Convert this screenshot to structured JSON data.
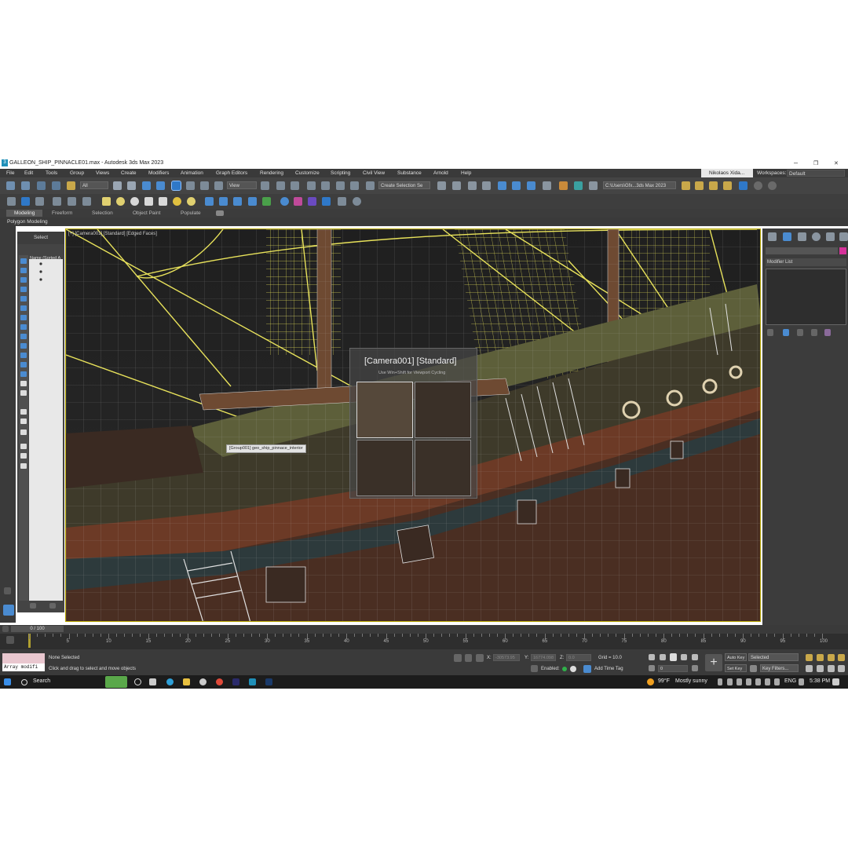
{
  "window": {
    "title": "GALLEON_SHIP_PINNACLE01.max - Autodesk 3ds Max 2023",
    "app_icon": "3",
    "minimize_glyph": "–",
    "restore_glyph": "❐",
    "close_glyph": "✕"
  },
  "menu": {
    "items": [
      "File",
      "Edit",
      "Tools",
      "Group",
      "Views",
      "Create",
      "Modifiers",
      "Animation",
      "Graph Editors",
      "Rendering",
      "Customize",
      "Scripting",
      "Civil View",
      "Substance",
      "Arnold",
      "Help"
    ],
    "user": "Nikolaos Xida...",
    "workspaces_label": "Workspaces:",
    "workspace_value": "Default"
  },
  "toolbar": {
    "filter_value": "All",
    "refcoord_value": "View",
    "selection_set_placeholder": "Create Selection Se",
    "project_path": "C:\\Users\\Gfx...3ds Max 2023"
  },
  "ribbon": {
    "tabs": [
      "Modeling",
      "Freeform",
      "Selection",
      "Object Paint",
      "Populate"
    ],
    "sub_label": "Polygon Modeling"
  },
  "scene_explorer": {
    "select_label": "Select",
    "column_header": "Name (Sorted A"
  },
  "viewport": {
    "label": "[+] [Camera001] [Standard] [Edged Faces]",
    "tooltip": "[Group001] geo_ship_pinnace_interior"
  },
  "camera_overlay": {
    "title": "[Camera001] [Standard]",
    "hint": "Use Win+Shift for Viewport Cycling"
  },
  "command_panel": {
    "modifier_list": "Modifier List",
    "swatch_color": "#d6329a"
  },
  "timeline": {
    "frame_counter": "0 / 100",
    "ticks": [
      "5",
      "10",
      "15",
      "20",
      "25",
      "30",
      "35",
      "40",
      "45",
      "50",
      "55",
      "60",
      "65",
      "70",
      "75",
      "80",
      "85",
      "90",
      "95",
      "100"
    ]
  },
  "status": {
    "maxscript": "Array modifi",
    "selection": "None Selected",
    "prompt": "Click and drag to select and move objects",
    "x_label": "X:",
    "x_value": "-30573.95",
    "y_label": "Y:",
    "y_value": "16774.098",
    "z_label": "Z:",
    "z_value": "0.0",
    "grid": "Grid = 10.0",
    "enabled": "Enabled:",
    "add_time_tag": "Add Time Tag",
    "auto_key": "Auto Key",
    "set_key": "Set Key",
    "key_mode": "Selected",
    "key_filters": "Key Filters...",
    "frame_field": "0"
  },
  "taskbar": {
    "search": "Search",
    "weather_temp": "99°F",
    "weather_desc": "Mostly sunny",
    "lang": "ENG",
    "time": "5:38 PM"
  },
  "colors": {
    "wire_yellow": "#e8e25a",
    "viewport_border": "#b8a800",
    "accent_blue": "#4a8bd0"
  }
}
